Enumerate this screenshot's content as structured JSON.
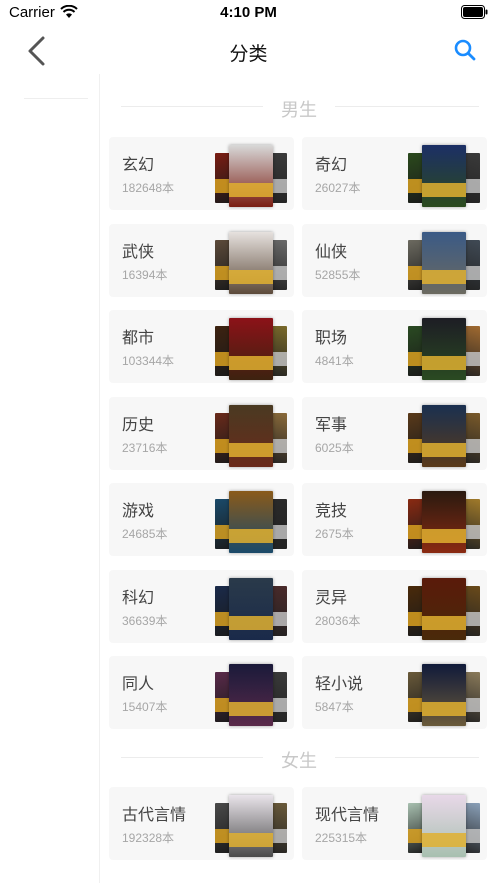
{
  "status_bar": {
    "carrier": "Carrier",
    "time": "4:10 PM"
  },
  "nav": {
    "title": "分类",
    "back_icon": "chevron-left-icon",
    "search_icon": "search-icon",
    "accent": "#1a8cff"
  },
  "sections": [
    {
      "title": "男生",
      "categories": [
        {
          "name": "玄幻",
          "count": "182648本",
          "colors": [
            "#7a1d12",
            "#d8d8d8",
            "#3b3b3b"
          ]
        },
        {
          "name": "奇幻",
          "count": "26027本",
          "colors": [
            "#2b4a1d",
            "#1c2f66",
            "#3a3a3a"
          ]
        },
        {
          "name": "武侠",
          "count": "16394本",
          "colors": [
            "#5c4a3a",
            "#e6e1de",
            "#6a6a6a"
          ]
        },
        {
          "name": "仙侠",
          "count": "52855本",
          "colors": [
            "#6c6a60",
            "#3a5a86",
            "#404a55"
          ]
        },
        {
          "name": "都市",
          "count": "103344本",
          "colors": [
            "#3d2210",
            "#8c1218",
            "#7a6a2a"
          ]
        },
        {
          "name": "职场",
          "count": "4841本",
          "colors": [
            "#2a4a22",
            "#1d1d24",
            "#a06a30"
          ]
        },
        {
          "name": "历史",
          "count": "23716本",
          "colors": [
            "#6a2a1a",
            "#4a3a22",
            "#8a6a3a"
          ]
        },
        {
          "name": "军事",
          "count": "6025本",
          "colors": [
            "#5a3a1a",
            "#1a3050",
            "#7a5a2a"
          ]
        },
        {
          "name": "游戏",
          "count": "24685本",
          "colors": [
            "#1a4a6a",
            "#8a5a1a",
            "#2a2a2a"
          ]
        },
        {
          "name": "竞技",
          "count": "2675本",
          "colors": [
            "#8a2a12",
            "#2a1a10",
            "#a07a2a"
          ]
        },
        {
          "name": "科幻",
          "count": "36639本",
          "colors": [
            "#1a2a4a",
            "#2a3a4a",
            "#4a2a2a"
          ]
        },
        {
          "name": "灵异",
          "count": "28036本",
          "colors": [
            "#4a2a0a",
            "#5a1a0a",
            "#6a4a1a"
          ]
        },
        {
          "name": "同人",
          "count": "15407本",
          "colors": [
            "#5a2a4a",
            "#1a1a3a",
            "#3a3a3a"
          ]
        },
        {
          "name": "轻小说",
          "count": "5847本",
          "colors": [
            "#6a5a3a",
            "#101a3a",
            "#8a7a5a"
          ]
        }
      ]
    },
    {
      "title": "女生",
      "categories": [
        {
          "name": "古代言情",
          "count": "192328本",
          "colors": [
            "#4a4a4a",
            "#e9e4ea",
            "#6a5a3a"
          ]
        },
        {
          "name": "现代言情",
          "count": "225315本",
          "colors": [
            "#a8c0b0",
            "#e8d8e8",
            "#8aa0b8"
          ]
        }
      ]
    }
  ]
}
